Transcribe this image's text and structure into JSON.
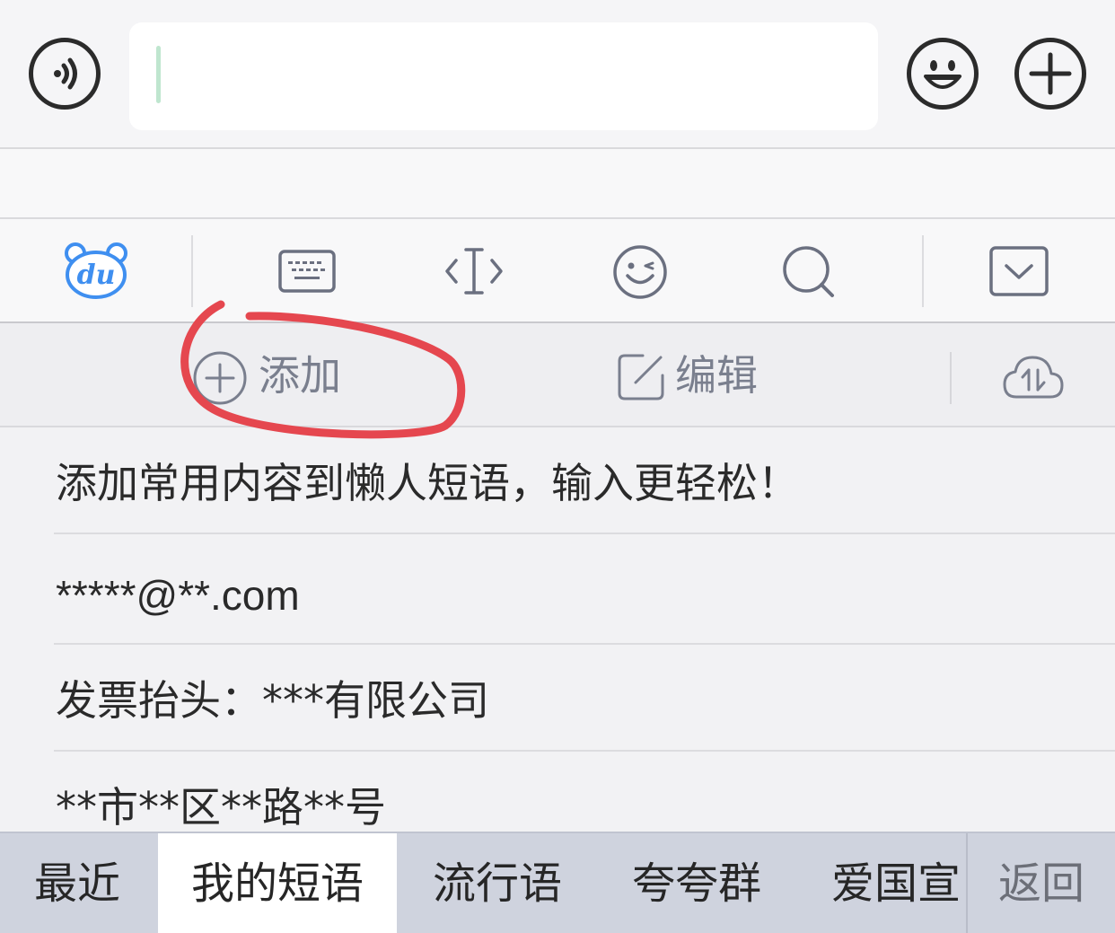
{
  "input_bar": {
    "voice_icon": "voice-icon",
    "emoji_icon": "smiley-icon",
    "plus_icon": "plus-icon",
    "input_value": ""
  },
  "toolbar": {
    "logo_text": "du",
    "icons": [
      "du-logo-icon",
      "keyboard-icon",
      "cursor-move-icon",
      "emoji-icon",
      "search-icon",
      "collapse-keyboard-icon"
    ]
  },
  "actions": {
    "add_label": "添加",
    "edit_label": "编辑",
    "cloud_icon": "cloud-sync-icon"
  },
  "phrases": [
    "添加常用内容到懒人短语，输入更轻松！",
    "*****@**.com",
    "发票抬头：***有限公司",
    "**市**区**路**号"
  ],
  "tabs": {
    "items": [
      "最近",
      "我的短语",
      "流行语",
      "夸夸群",
      "爱国宣"
    ],
    "active": "我的短语",
    "back_label": "返回"
  },
  "colors": {
    "annotation": "#e5474f",
    "logo": "#3f8ff0",
    "icon_gray": "#6b7080"
  }
}
